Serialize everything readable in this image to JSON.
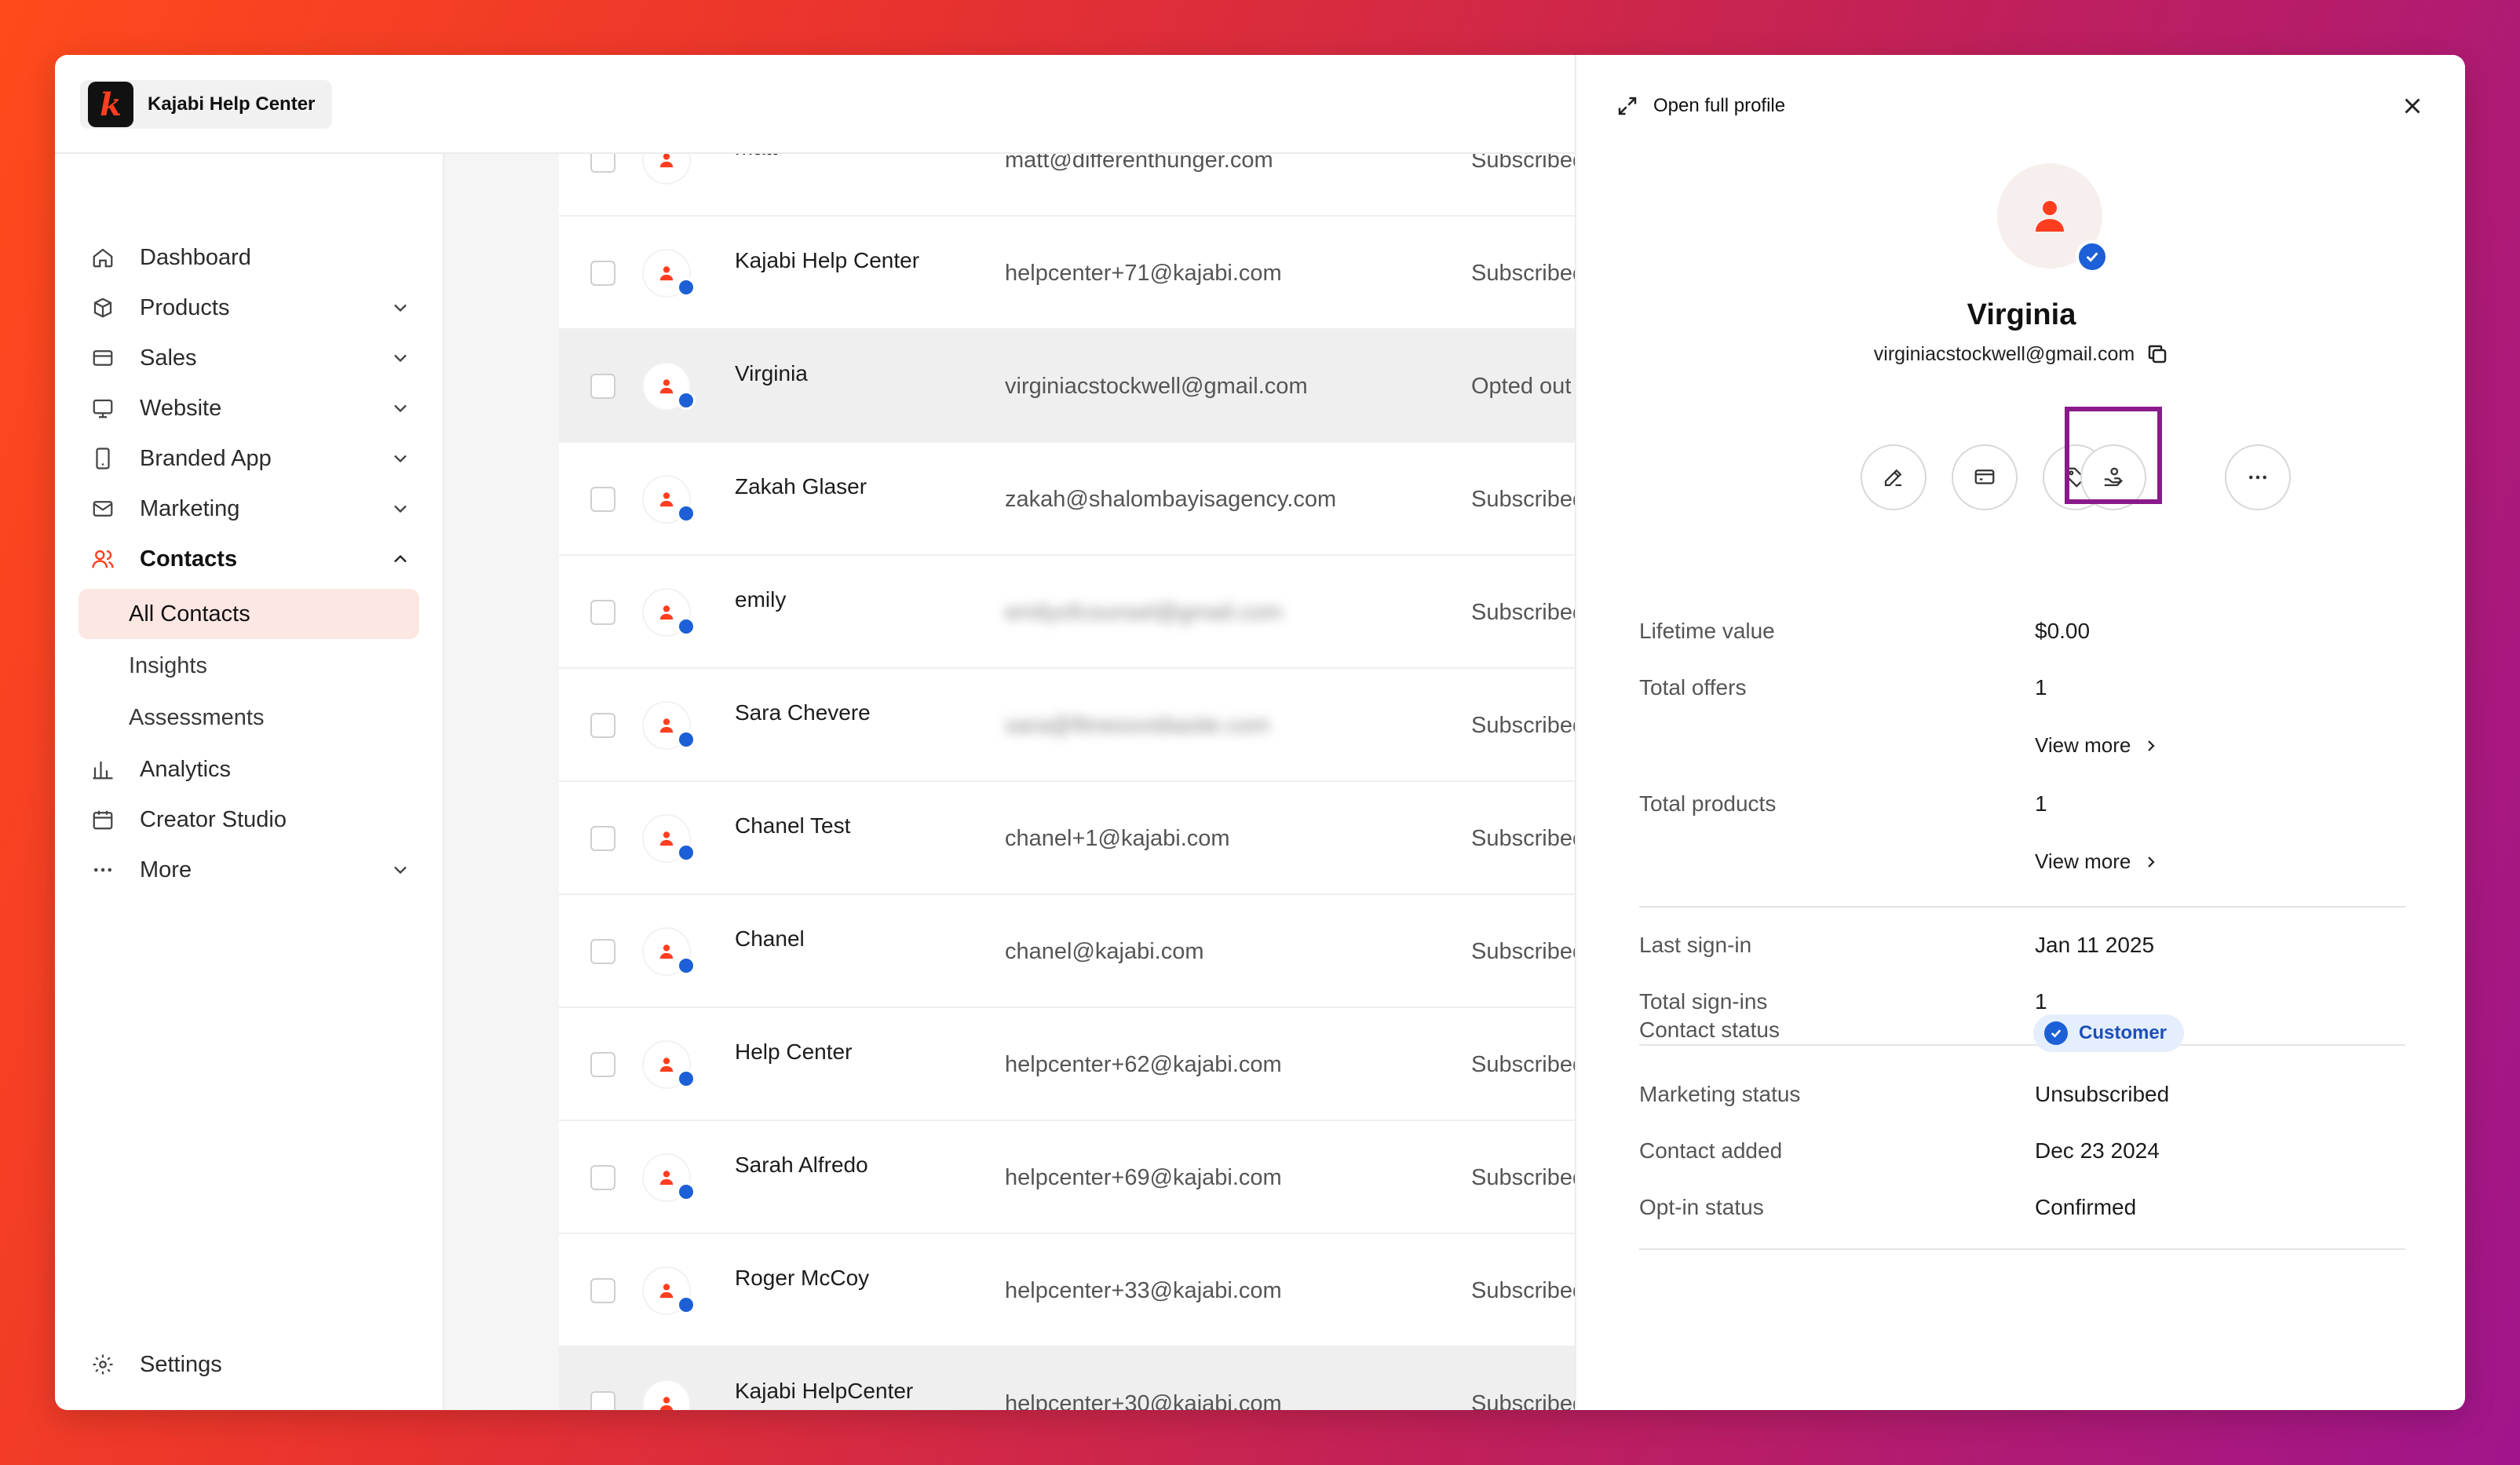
{
  "brand": {
    "name": "Kajabi Help Center",
    "logo_letter": "k"
  },
  "sidebar": {
    "items": [
      {
        "label": "Dashboard",
        "icon": "home-icon",
        "has_chevron": false
      },
      {
        "label": "Products",
        "icon": "box-icon",
        "has_chevron": true
      },
      {
        "label": "Sales",
        "icon": "credit-card-icon",
        "has_chevron": true
      },
      {
        "label": "Website",
        "icon": "monitor-icon",
        "has_chevron": true
      },
      {
        "label": "Branded App",
        "icon": "phone-icon",
        "has_chevron": true
      },
      {
        "label": "Marketing",
        "icon": "mail-icon",
        "has_chevron": true
      },
      {
        "label": "Contacts",
        "icon": "users-icon",
        "has_chevron": true,
        "expanded": true
      }
    ],
    "contacts_sub": [
      {
        "label": "All Contacts",
        "active": true
      },
      {
        "label": "Insights",
        "active": false
      },
      {
        "label": "Assessments",
        "active": false
      }
    ],
    "items_after": [
      {
        "label": "Analytics",
        "icon": "bar-chart-icon"
      },
      {
        "label": "Creator Studio",
        "icon": "calendar-icon"
      },
      {
        "label": "More",
        "icon": "ellipsis-icon"
      }
    ],
    "settings_label": "Settings"
  },
  "contacts": {
    "rows": [
      {
        "name": "matt",
        "email": "matt@differenthunger.com",
        "status": "Subscribed",
        "verified": false
      },
      {
        "name": "Kajabi Help Center",
        "email": "helpcenter+71@kajabi.com",
        "status": "Subscribed",
        "verified": true
      },
      {
        "name": "Virginia",
        "email": "virginiacstockwell@gmail.com",
        "status": "Opted out",
        "verified": true,
        "selected": true
      },
      {
        "name": "Zakah Glaser",
        "email": "zakah@shalombayisagency.com",
        "status": "Subscribed",
        "verified": true
      },
      {
        "name": "emily",
        "email": "emilyofcounsel@gmail.com",
        "status": "Subscribed",
        "verified": true,
        "blurred": true
      },
      {
        "name": "Sara Chevere",
        "email": "sara@fitnessvidiasite.com",
        "status": "Subscribed",
        "verified": true,
        "blurred": true
      },
      {
        "name": "Chanel Test",
        "email": "chanel+1@kajabi.com",
        "status": "Subscribed",
        "verified": true
      },
      {
        "name": "Chanel",
        "email": "chanel@kajabi.com",
        "status": "Subscribed",
        "verified": true
      },
      {
        "name": "Help Center",
        "email": "helpcenter+62@kajabi.com",
        "status": "Subscribed",
        "verified": true
      },
      {
        "name": "Sarah Alfredo",
        "email": "helpcenter+69@kajabi.com",
        "status": "Subscribed",
        "verified": true
      },
      {
        "name": "Roger McCoy",
        "email": "helpcenter+33@kajabi.com",
        "status": "Subscribed",
        "verified": true
      },
      {
        "name": "Kajabi HelpCenter",
        "email": "helpcenter+30@kajabi.com",
        "status": "Subscribed",
        "verified": false,
        "partial": true
      }
    ]
  },
  "panel": {
    "open_full_label": "Open full profile",
    "name": "Virginia",
    "email": "virginiacstockwell@gmail.com",
    "actions": [
      "edit-icon",
      "payment-icon",
      "tag-icon",
      "grant-access-icon",
      "more-icon"
    ],
    "highlighted_action": "grant-access-icon",
    "lifetime_value_label": "Lifetime value",
    "lifetime_value": "$0.00",
    "total_offers_label": "Total offers",
    "total_offers": "1",
    "total_products_label": "Total products",
    "total_products": "1",
    "view_more_label": "View more",
    "last_signin_label": "Last sign-in",
    "last_signin": "Jan 11 2025",
    "total_signins_label": "Total sign-ins",
    "total_signins": "1",
    "contact_status_label": "Contact status",
    "contact_status": "Customer",
    "marketing_status_label": "Marketing status",
    "marketing_status": "Unsubscribed",
    "contact_added_label": "Contact added",
    "contact_added": "Dec 23 2024",
    "optin_status_label": "Opt-in status",
    "optin_status": "Confirmed"
  },
  "colors": {
    "accent": "#ff3d1f",
    "verified": "#1c5fd6",
    "highlight": "#8a1a8c"
  }
}
